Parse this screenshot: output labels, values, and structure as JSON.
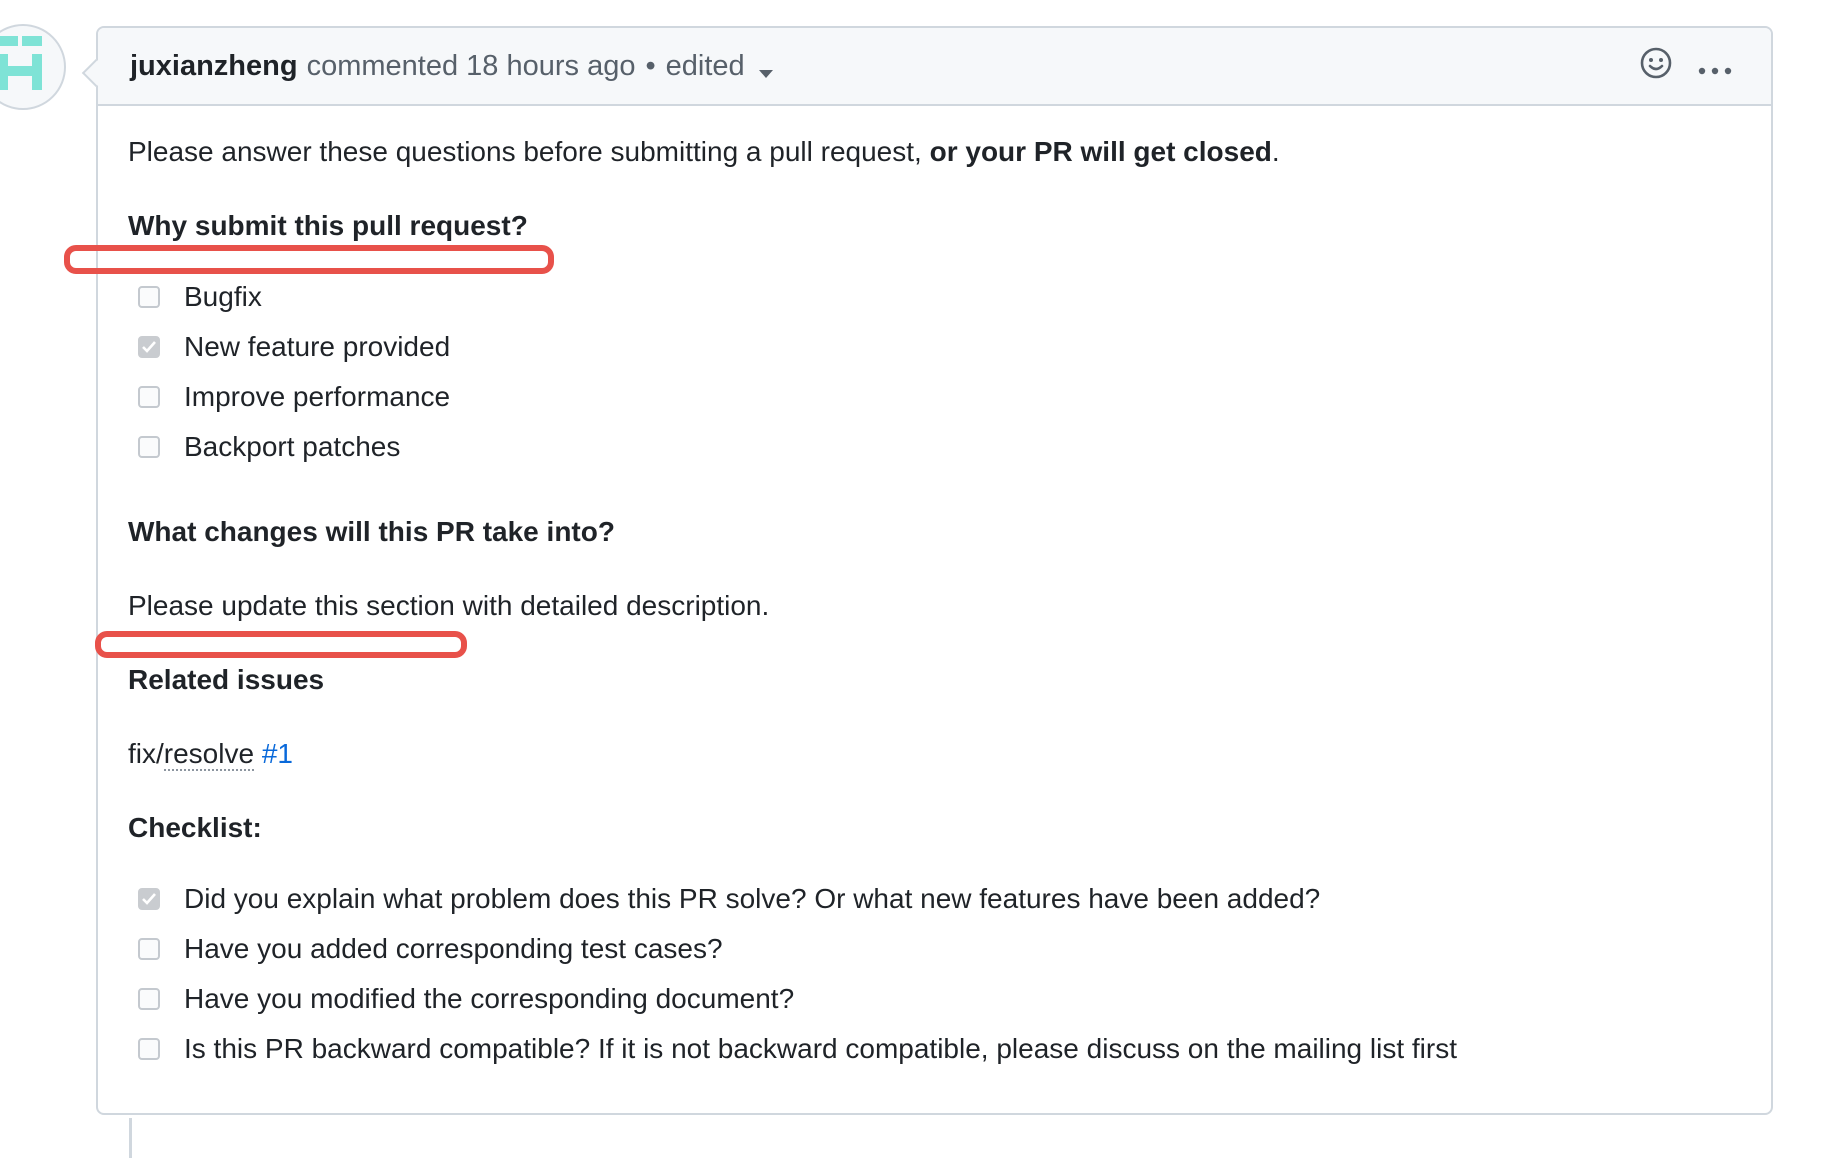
{
  "comment": {
    "author": "juxianzheng",
    "action": "commented",
    "time": "18 hours ago",
    "separator": "•",
    "edited_label": "edited"
  },
  "body": {
    "intro_plain": "Please answer these questions before submitting a pull request,",
    "intro_bold": "or your PR will get closed",
    "intro_end": ".",
    "why_heading": "Why submit this pull request?",
    "why_options": [
      {
        "label": "Bugfix",
        "checked": false
      },
      {
        "label": "New feature provided",
        "checked": true
      },
      {
        "label": "Improve performance",
        "checked": false
      },
      {
        "label": "Backport patches",
        "checked": false
      }
    ],
    "changes_heading": "What changes will this PR take into?",
    "changes_text": "Please update this section with detailed description.",
    "related_heading": "Related issues",
    "related_prefix": "fix/",
    "related_resolve": "resolve",
    "related_link": "#1",
    "checklist_heading": "Checklist:",
    "checklist": [
      {
        "label": "Did you explain what problem does this PR solve? Or what new features have been added?",
        "checked": true
      },
      {
        "label": "Have you added corresponding test cases?",
        "checked": false
      },
      {
        "label": "Have you modified the corresponding document?",
        "checked": false
      },
      {
        "label": "Is this PR backward compatible? If it is not backward compatible, please discuss on the mailing list first",
        "checked": false
      }
    ]
  },
  "icons": {
    "reaction": "smiley-icon",
    "more": "kebab-horizontal-icon",
    "dropdown": "chevron-down-icon"
  },
  "colors": {
    "annotation": "#e8514a",
    "link": "#0969da",
    "avatar": "#7fe3d6"
  }
}
